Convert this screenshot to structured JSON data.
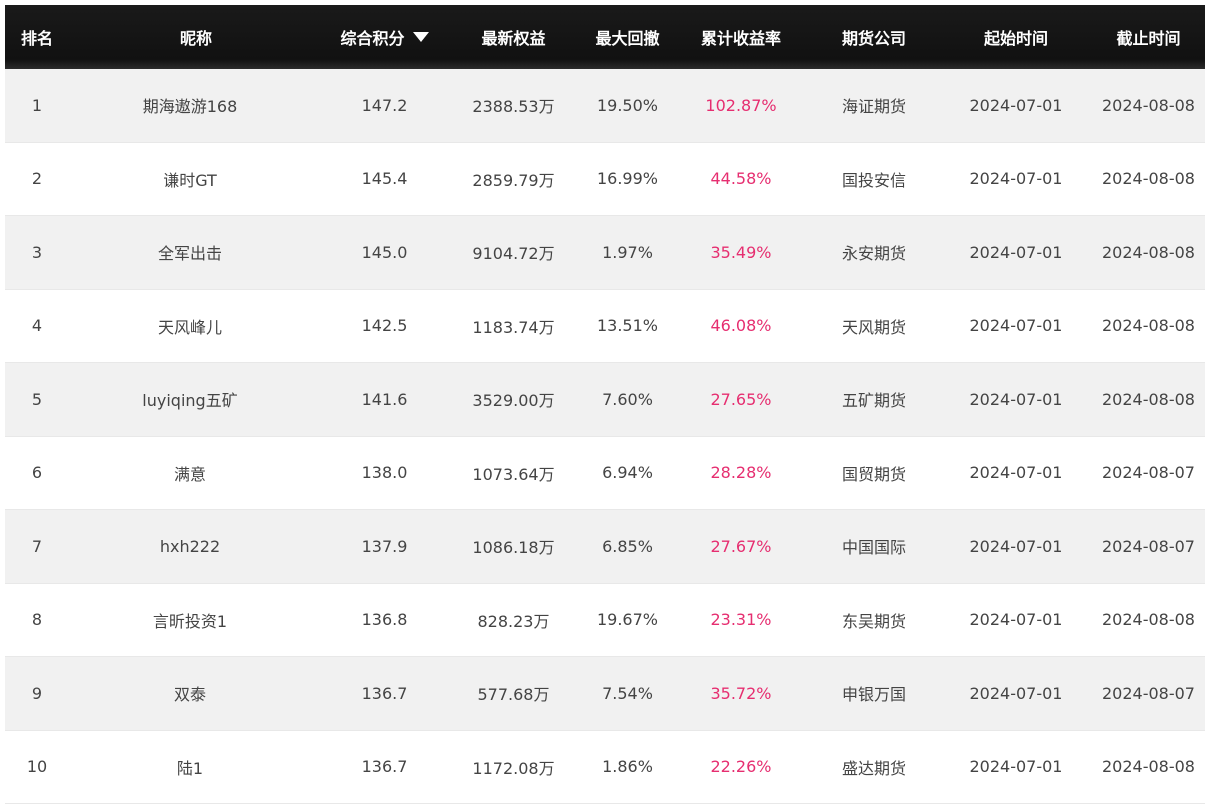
{
  "headers": {
    "rank": "排名",
    "nickname": "昵称",
    "score": "综合积分",
    "equity": "最新权益",
    "max_drawdown": "最大回撤",
    "cum_return": "累计收益率",
    "company": "期货公司",
    "start": "起始时间",
    "end": "截止时间"
  },
  "sort_icon": "triangle-down-icon",
  "colors": {
    "header_bg": "#111111",
    "return_text": "#e62e70",
    "odd_row": "#f1f1f1"
  },
  "rows": [
    {
      "rank": "1",
      "nickname": "期海遨游168",
      "score": "147.2",
      "equity": "2388.53万",
      "max_drawdown": "19.50%",
      "cum_return": "102.87%",
      "company": "海证期货",
      "start": "2024-07-01",
      "end": "2024-08-08"
    },
    {
      "rank": "2",
      "nickname": "谦时GT",
      "score": "145.4",
      "equity": "2859.79万",
      "max_drawdown": "16.99%",
      "cum_return": "44.58%",
      "company": "国投安信",
      "start": "2024-07-01",
      "end": "2024-08-08"
    },
    {
      "rank": "3",
      "nickname": "全军出击",
      "score": "145.0",
      "equity": "9104.72万",
      "max_drawdown": "1.97%",
      "cum_return": "35.49%",
      "company": "永安期货",
      "start": "2024-07-01",
      "end": "2024-08-08"
    },
    {
      "rank": "4",
      "nickname": "天风峰儿",
      "score": "142.5",
      "equity": "1183.74万",
      "max_drawdown": "13.51%",
      "cum_return": "46.08%",
      "company": "天风期货",
      "start": "2024-07-01",
      "end": "2024-08-08"
    },
    {
      "rank": "5",
      "nickname": "luyiqing五矿",
      "score": "141.6",
      "equity": "3529.00万",
      "max_drawdown": "7.60%",
      "cum_return": "27.65%",
      "company": "五矿期货",
      "start": "2024-07-01",
      "end": "2024-08-08"
    },
    {
      "rank": "6",
      "nickname": "满意",
      "score": "138.0",
      "equity": "1073.64万",
      "max_drawdown": "6.94%",
      "cum_return": "28.28%",
      "company": "国贸期货",
      "start": "2024-07-01",
      "end": "2024-08-07"
    },
    {
      "rank": "7",
      "nickname": "hxh222",
      "score": "137.9",
      "equity": "1086.18万",
      "max_drawdown": "6.85%",
      "cum_return": "27.67%",
      "company": "中国国际",
      "start": "2024-07-01",
      "end": "2024-08-07"
    },
    {
      "rank": "8",
      "nickname": "言昕投资1",
      "score": "136.8",
      "equity": "828.23万",
      "max_drawdown": "19.67%",
      "cum_return": "23.31%",
      "company": "东吴期货",
      "start": "2024-07-01",
      "end": "2024-08-08"
    },
    {
      "rank": "9",
      "nickname": "双泰",
      "score": "136.7",
      "equity": "577.68万",
      "max_drawdown": "7.54%",
      "cum_return": "35.72%",
      "company": "申银万国",
      "start": "2024-07-01",
      "end": "2024-08-07"
    },
    {
      "rank": "10",
      "nickname": "陆1",
      "score": "136.7",
      "equity": "1172.08万",
      "max_drawdown": "1.86%",
      "cum_return": "22.26%",
      "company": "盛达期货",
      "start": "2024-07-01",
      "end": "2024-08-08"
    }
  ]
}
